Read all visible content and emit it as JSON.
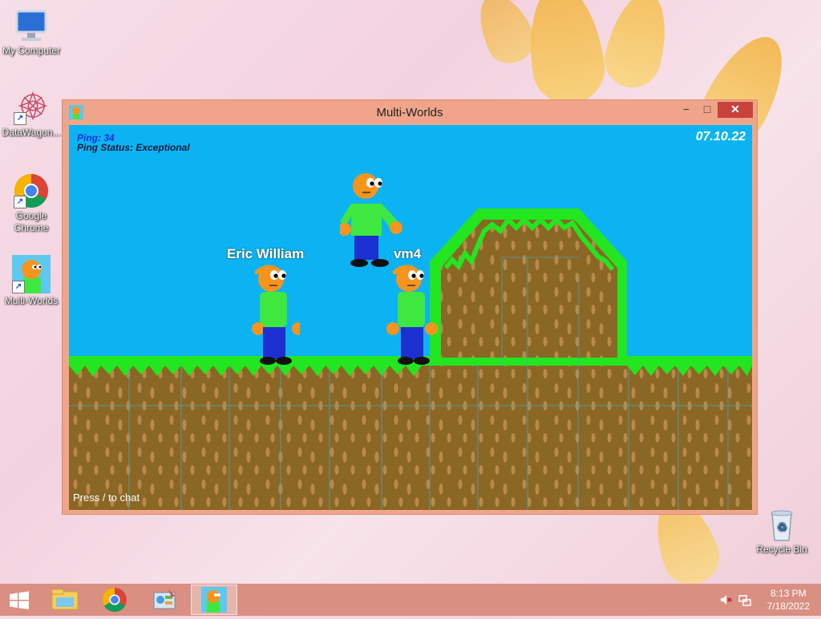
{
  "desktop": {
    "icons": [
      {
        "label": "My Computer",
        "icon": "computer-icon"
      },
      {
        "label": "DataWagon...",
        "icon": "datawagon-icon"
      },
      {
        "label": "Google Chrome",
        "icon": "chrome-icon"
      },
      {
        "label": "Multi-Worlds",
        "icon": "game-icon"
      },
      {
        "label": "Recycle Bin",
        "icon": "recycle-bin-icon"
      }
    ]
  },
  "window": {
    "title": "Multi-Worlds",
    "minimize_label": "−",
    "maximize_label": "□",
    "close_label": "✕"
  },
  "game": {
    "ping": "Ping: 34",
    "ping_status": "Ping Status: Exceptional",
    "date": "07.10.22",
    "chat_hint": "Press / to chat",
    "players": [
      {
        "name": "Eric William"
      },
      {
        "name": "vm4"
      },
      {
        "name": ""
      }
    ],
    "colors": {
      "sky": "#0cb3f2",
      "grass": "#22e620",
      "dirt": "#8a6724",
      "skin": "#f7941d",
      "shirt": "#3ee83e",
      "pants": "#1c2fd0"
    }
  },
  "taskbar": {
    "items": [
      {
        "name": "start",
        "icon": "windows-logo-icon"
      },
      {
        "name": "file-explorer",
        "icon": "folder-icon"
      },
      {
        "name": "chrome",
        "icon": "chrome-icon"
      },
      {
        "name": "control-panel",
        "icon": "control-panel-icon"
      },
      {
        "name": "multi-worlds",
        "icon": "game-icon",
        "active": true
      }
    ],
    "time": "8:13 PM",
    "date": "7/18/2022"
  }
}
